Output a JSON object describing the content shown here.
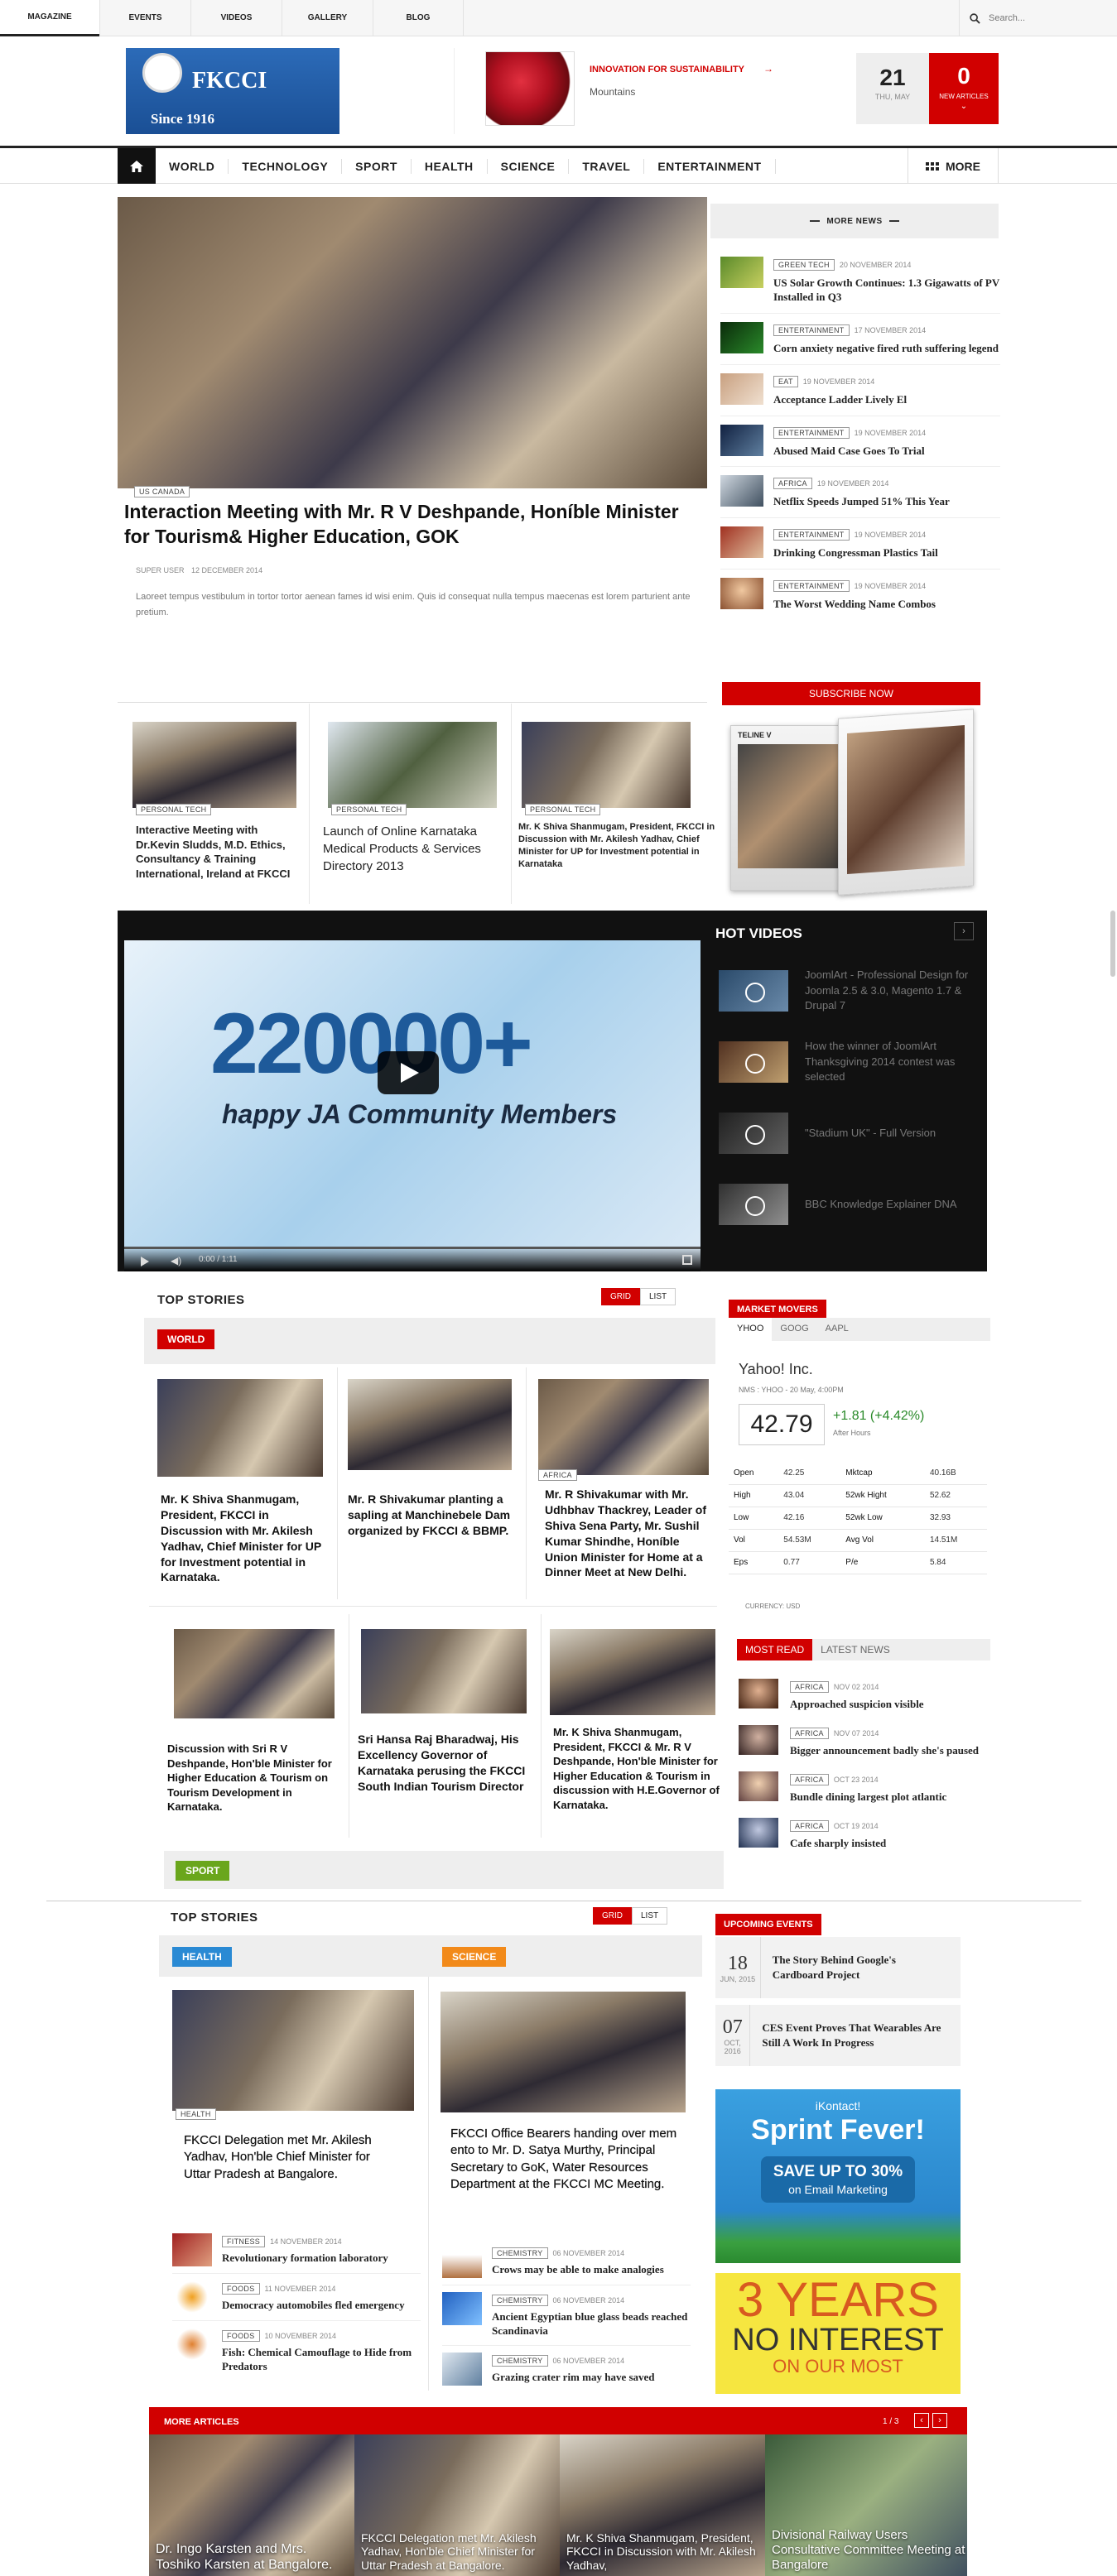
{
  "topnav": {
    "items": [
      "MAGAZINE",
      "EVENTS",
      "VIDEOS",
      "GALLERY",
      "BLOG"
    ],
    "search_placeholder": "Search..."
  },
  "logo": {
    "name": "FKCCI",
    "since": "Since 1916"
  },
  "promo": {
    "title": "INNOVATION FOR SUSTAINABILITY",
    "subtitle": "Mountains"
  },
  "date_box": {
    "day": "21",
    "sub": "THU, MAY"
  },
  "new_articles": {
    "count": "0",
    "label": "NEW ARTICLES"
  },
  "mainnav": {
    "items": [
      "WORLD",
      "TECHNOLOGY",
      "SPORT",
      "HEALTH",
      "SCIENCE",
      "TRAVEL",
      "ENTERTAINMENT"
    ],
    "more": "MORE"
  },
  "featured": {
    "tag": "US CANADA",
    "title": "Interaction Meeting with Mr. R V Deshpande, Honíble Minister for Tourism& Higher Education, GOK",
    "author": "SUPER USER",
    "date": "12 DECEMBER 2014",
    "excerpt": "Laoreet tempus vestibulum in tortor tortor aenean fames id wisi enim. Quis id consequat nulla tempus maecenas est lorem parturient ante pretium."
  },
  "more_news": {
    "title": "MORE NEWS",
    "items": [
      {
        "tag": "GREEN TECH",
        "date": "20 NOVEMBER 2014",
        "title": "US Solar Growth Continues: 1.3 Gigawatts of PV Installed in Q3"
      },
      {
        "tag": "ENTERTAINMENT",
        "date": "17 NOVEMBER 2014",
        "title": "Corn anxiety negative fired ruth suffering legend"
      },
      {
        "tag": "EAT",
        "date": "19 NOVEMBER 2014",
        "title": "Acceptance Ladder Lively El"
      },
      {
        "tag": "ENTERTAINMENT",
        "date": "19 NOVEMBER 2014",
        "title": "Abused Maid Case Goes To Trial"
      },
      {
        "tag": "AFRICA",
        "date": "19 NOVEMBER 2014",
        "title": "Netflix Speeds Jumped 51% This Year"
      },
      {
        "tag": "ENTERTAINMENT",
        "date": "19 NOVEMBER 2014",
        "title": "Drinking Congressman Plastics Tail"
      },
      {
        "tag": "ENTERTAINMENT",
        "date": "19 NOVEMBER 2014",
        "title": "The Worst Wedding Name Combos"
      }
    ]
  },
  "subscribe": {
    "label": "SUBSCRIBE NOW",
    "magazine": "TELINE V"
  },
  "mini_articles": [
    {
      "tag": "PERSONAL TECH",
      "title": "Interactive Meeting with Dr.Kevin Sludds, M.D. Ethics, Consultancy & Training International, Ireland at FKCCI"
    },
    {
      "tag": "PERSONAL TECH",
      "title": "Launch of Online  Karnataka Medical Products & Services Directory 2013"
    },
    {
      "tag": "PERSONAL TECH",
      "title": "Mr. K Shiva Shanmugam, President, FKCCI in Discussion with Mr. Akilesh Yadhav, Chief Minister for UP for Investment potential in Karnataka"
    }
  ],
  "video": {
    "big_text": "220000+",
    "sub_text": "happy JA Community Members",
    "time": "0:00 / 1:11"
  },
  "hot_videos": {
    "title": "HOT VIDEOS",
    "items": [
      "JoomlArt - Professional Design for Joomla 2.5 & 3.0, Magento 1.7 & Drupal 7",
      "How the winner of JoomlArt Thanksgiving 2014 contest was selected",
      "\"Stadium UK\" - Full Version",
      "BBC Knowledge Explainer DNA"
    ]
  },
  "top_stories_1": {
    "title": "TOP STORIES",
    "grid": "GRID",
    "list": "LIST",
    "section": "WORLD",
    "row1": [
      {
        "title": "Mr. K Shiva Shanmugam, President, FKCCI in Discussion with Mr. Akilesh Yadhav, Chief Minister for UP for Investment potential in Karnataka."
      },
      {
        "title": "Mr. R Shivakumar planting a sapling at Manchinebele Dam organized by FKCCI & BBMP."
      },
      {
        "tag": "AFRICA",
        "title": "Mr. R Shivakumar with Mr. Udhbhav Thackrey, Leader of Shiva Sena Party, Mr. Sushil Kumar Shindhe, Honíble Union Minister for Home at a Dinner Meet at New Delhi."
      }
    ],
    "row2": [
      {
        "title": "Discussion with Sri R V Deshpande, Hon'ble Minister for Higher Education & Tourism on Tourism Development in Karnataka."
      },
      {
        "title": "Sri Hansa Raj Bharadwaj, His Excellency Governor of Karnataka perusing the FKCCI South Indian Tourism Director"
      },
      {
        "title": "Mr. K Shiva Shanmugam, President, FKCCI & Mr. R V Deshpande, Hon'ble Minister for Higher Education & Tourism in discussion with H.E.Governor of Karnataka."
      }
    ],
    "sport": "SPORT"
  },
  "market": {
    "title": "MARKET MOVERS",
    "tabs": [
      "YHOO",
      "GOOG",
      "AAPL"
    ],
    "company": "Yahoo! Inc.",
    "exchange": "NMS : YHOO - 20 May, 4:00PM",
    "price": "42.79",
    "change": "+1.81 (+4.42%)",
    "after": "After Hours",
    "rows": [
      [
        "Open",
        "42.25",
        "Mktcap",
        "40.16B"
      ],
      [
        "High",
        "43.04",
        "52wk Hight",
        "52.62"
      ],
      [
        "Low",
        "42.16",
        "52wk Low",
        "32.93"
      ],
      [
        "Vol",
        "54.53M",
        "Avg Vol",
        "14.51M"
      ],
      [
        "Eps",
        "0.77",
        "P/e",
        "5.84"
      ]
    ],
    "currency": "CURRENCY: USD"
  },
  "most_read": {
    "tabs": [
      "MOST READ",
      "LATEST NEWS"
    ],
    "items": [
      {
        "tag": "AFRICA",
        "date": "NOV 02 2014",
        "title": "Approached suspicion visible"
      },
      {
        "tag": "AFRICA",
        "date": "NOV 07 2014",
        "title": "Bigger announcement badly she's paused"
      },
      {
        "tag": "AFRICA",
        "date": "OCT 23 2014",
        "title": "Bundle dining largest plot atlantic"
      },
      {
        "tag": "AFRICA",
        "date": "OCT 19 2014",
        "title": "Cafe sharply insisted"
      }
    ]
  },
  "top_stories_2": {
    "title": "TOP STORIES",
    "grid": "GRID",
    "list": "LIST",
    "health": {
      "label": "HEALTH",
      "feature_tag": "HEALTH",
      "feature_title": "FKCCI Delegation met Mr. Akilesh Yadhav, Hon'ble Chief Minister for Uttar Pradesh at Bangalore.",
      "items": [
        {
          "tag": "FITNESS",
          "date": "14 NOVEMBER 2014",
          "title": "Revolutionary formation laboratory"
        },
        {
          "tag": "FOODS",
          "date": "11 NOVEMBER 2014",
          "title": "Democracy automobiles fled emergency"
        },
        {
          "tag": "FOODS",
          "date": "10 NOVEMBER 2014",
          "title": "Fish: Chemical Camouflage to Hide from Predators"
        }
      ]
    },
    "science": {
      "label": "SCIENCE",
      "feature_title": "FKCCI Office Bearers handing over mem ento to Mr. D. Satya Murthy, Principal Secretary to GoK, Water Resources Department at the FKCCI MC Meeting.",
      "items": [
        {
          "tag": "CHEMISTRY",
          "date": "06 NOVEMBER 2014",
          "title": "Crows may be able to make analogies"
        },
        {
          "tag": "CHEMISTRY",
          "date": "06 NOVEMBER 2014",
          "title": "Ancient Egyptian blue glass beads reached Scandinavia"
        },
        {
          "tag": "CHEMISTRY",
          "date": "06 NOVEMBER 2014",
          "title": "Grazing crater rim may have saved"
        }
      ]
    }
  },
  "events": {
    "title": "UPCOMING EVENTS",
    "items": [
      {
        "day": "18",
        "mon": "JUN, 2015",
        "title": "The Story Behind Google's Cardboard Project"
      },
      {
        "day": "07",
        "mon": "OCT, 2016",
        "title": "CES Event Proves That Wearables Are Still A Work In Progress"
      }
    ]
  },
  "ad1": {
    "brand": "iKontact!",
    "headline": "Sprint Fever!",
    "offer": "SAVE UP TO 30%",
    "offer_sub": "on Email Marketing"
  },
  "ad2": {
    "line1": "3 YEARS",
    "line2": "NO INTEREST",
    "line3": "ON OUR MOST"
  },
  "more_articles": {
    "title": "MORE ARTICLES",
    "pager": "1 / 3",
    "items": [
      "Dr. Ingo Karsten and Mrs. Toshiko Karsten at Bangalore.",
      "FKCCI Delegation met Mr. Akilesh Yadhav, Hon'ble Chief Minister for Uttar Pradesh at Bangalore.",
      "Mr. K Shiva Shanmugam, President, FKCCI in Discussion with Mr. Akilesh Yadhav,",
      "Divisional Railway Users Consultative Committee Meeting at Bangalore"
    ]
  },
  "colors": {
    "accent": "#d10000",
    "blue": "#2a8ad4",
    "orange": "#f28a1a",
    "green": "#6aa61c",
    "dark": "#111111"
  }
}
